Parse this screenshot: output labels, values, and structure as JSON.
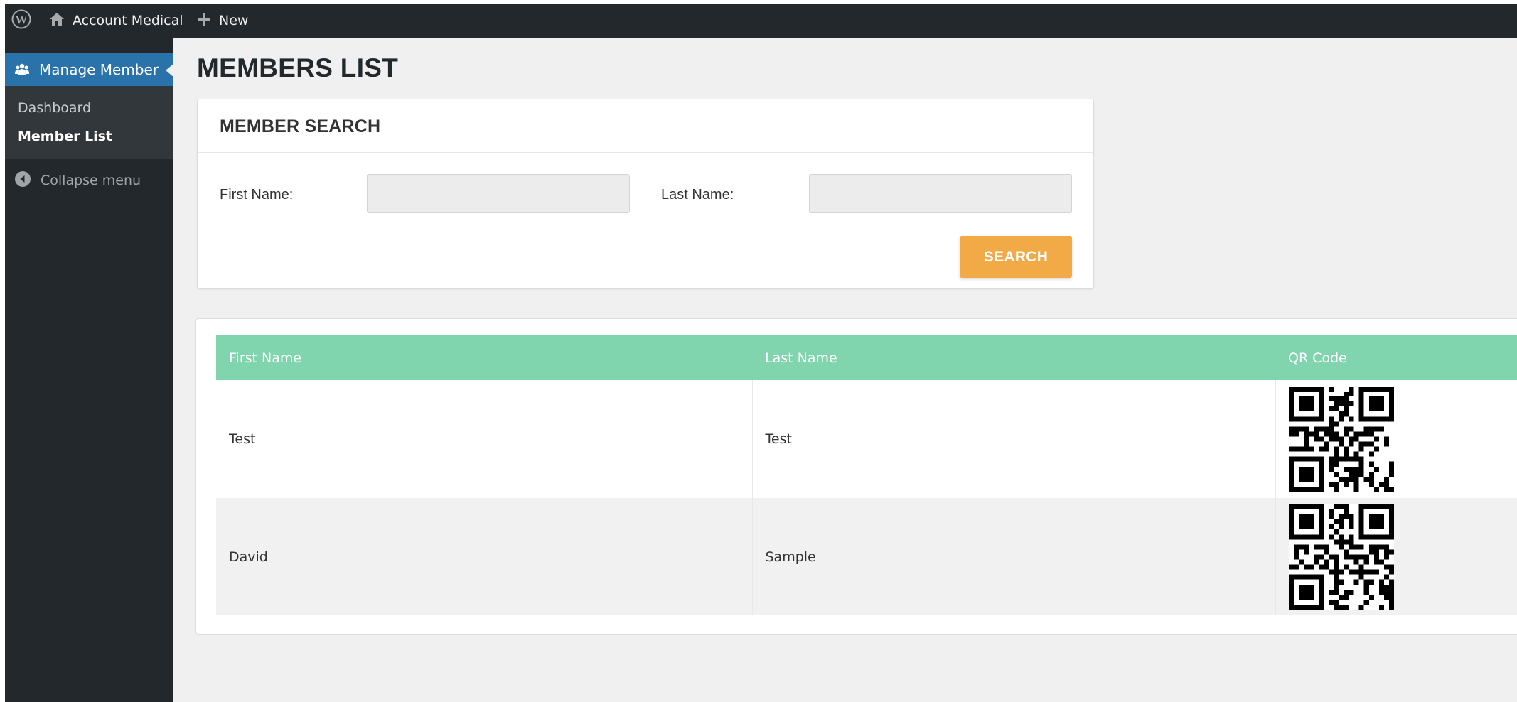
{
  "admin_bar": {
    "wp_logo_icon": "wordpress-logo-icon",
    "site_name": "Account Medical",
    "home_icon": "home-icon",
    "new_label": "New",
    "plus_icon": "plus-icon"
  },
  "sidebar": {
    "menu_label": "Manage Member",
    "menu_icon": "users-icon",
    "items": [
      {
        "label": "Dashboard",
        "current": false
      },
      {
        "label": "Member List",
        "current": true
      }
    ],
    "collapse_label": "Collapse menu",
    "collapse_icon": "collapse-arrow-icon"
  },
  "page": {
    "title": "MEMBERS LIST"
  },
  "search": {
    "title": "MEMBER SEARCH",
    "first_name_label": "First Name:",
    "first_name_value": "",
    "last_name_label": "Last Name:",
    "last_name_value": "",
    "button_label": "SEARCH"
  },
  "table": {
    "headers": [
      "First Name",
      "Last Name",
      "QR Code"
    ],
    "rows": [
      {
        "first_name": "Test",
        "last_name": "Test",
        "qr_icon": "qr-code-icon"
      },
      {
        "first_name": "David",
        "last_name": "Sample",
        "qr_icon": "qr-code-icon"
      }
    ]
  },
  "colors": {
    "admin_bar": "#23282d",
    "menu_active": "#2a73aa",
    "table_header": "#80d4ae",
    "search_button": "#f1aa46"
  }
}
